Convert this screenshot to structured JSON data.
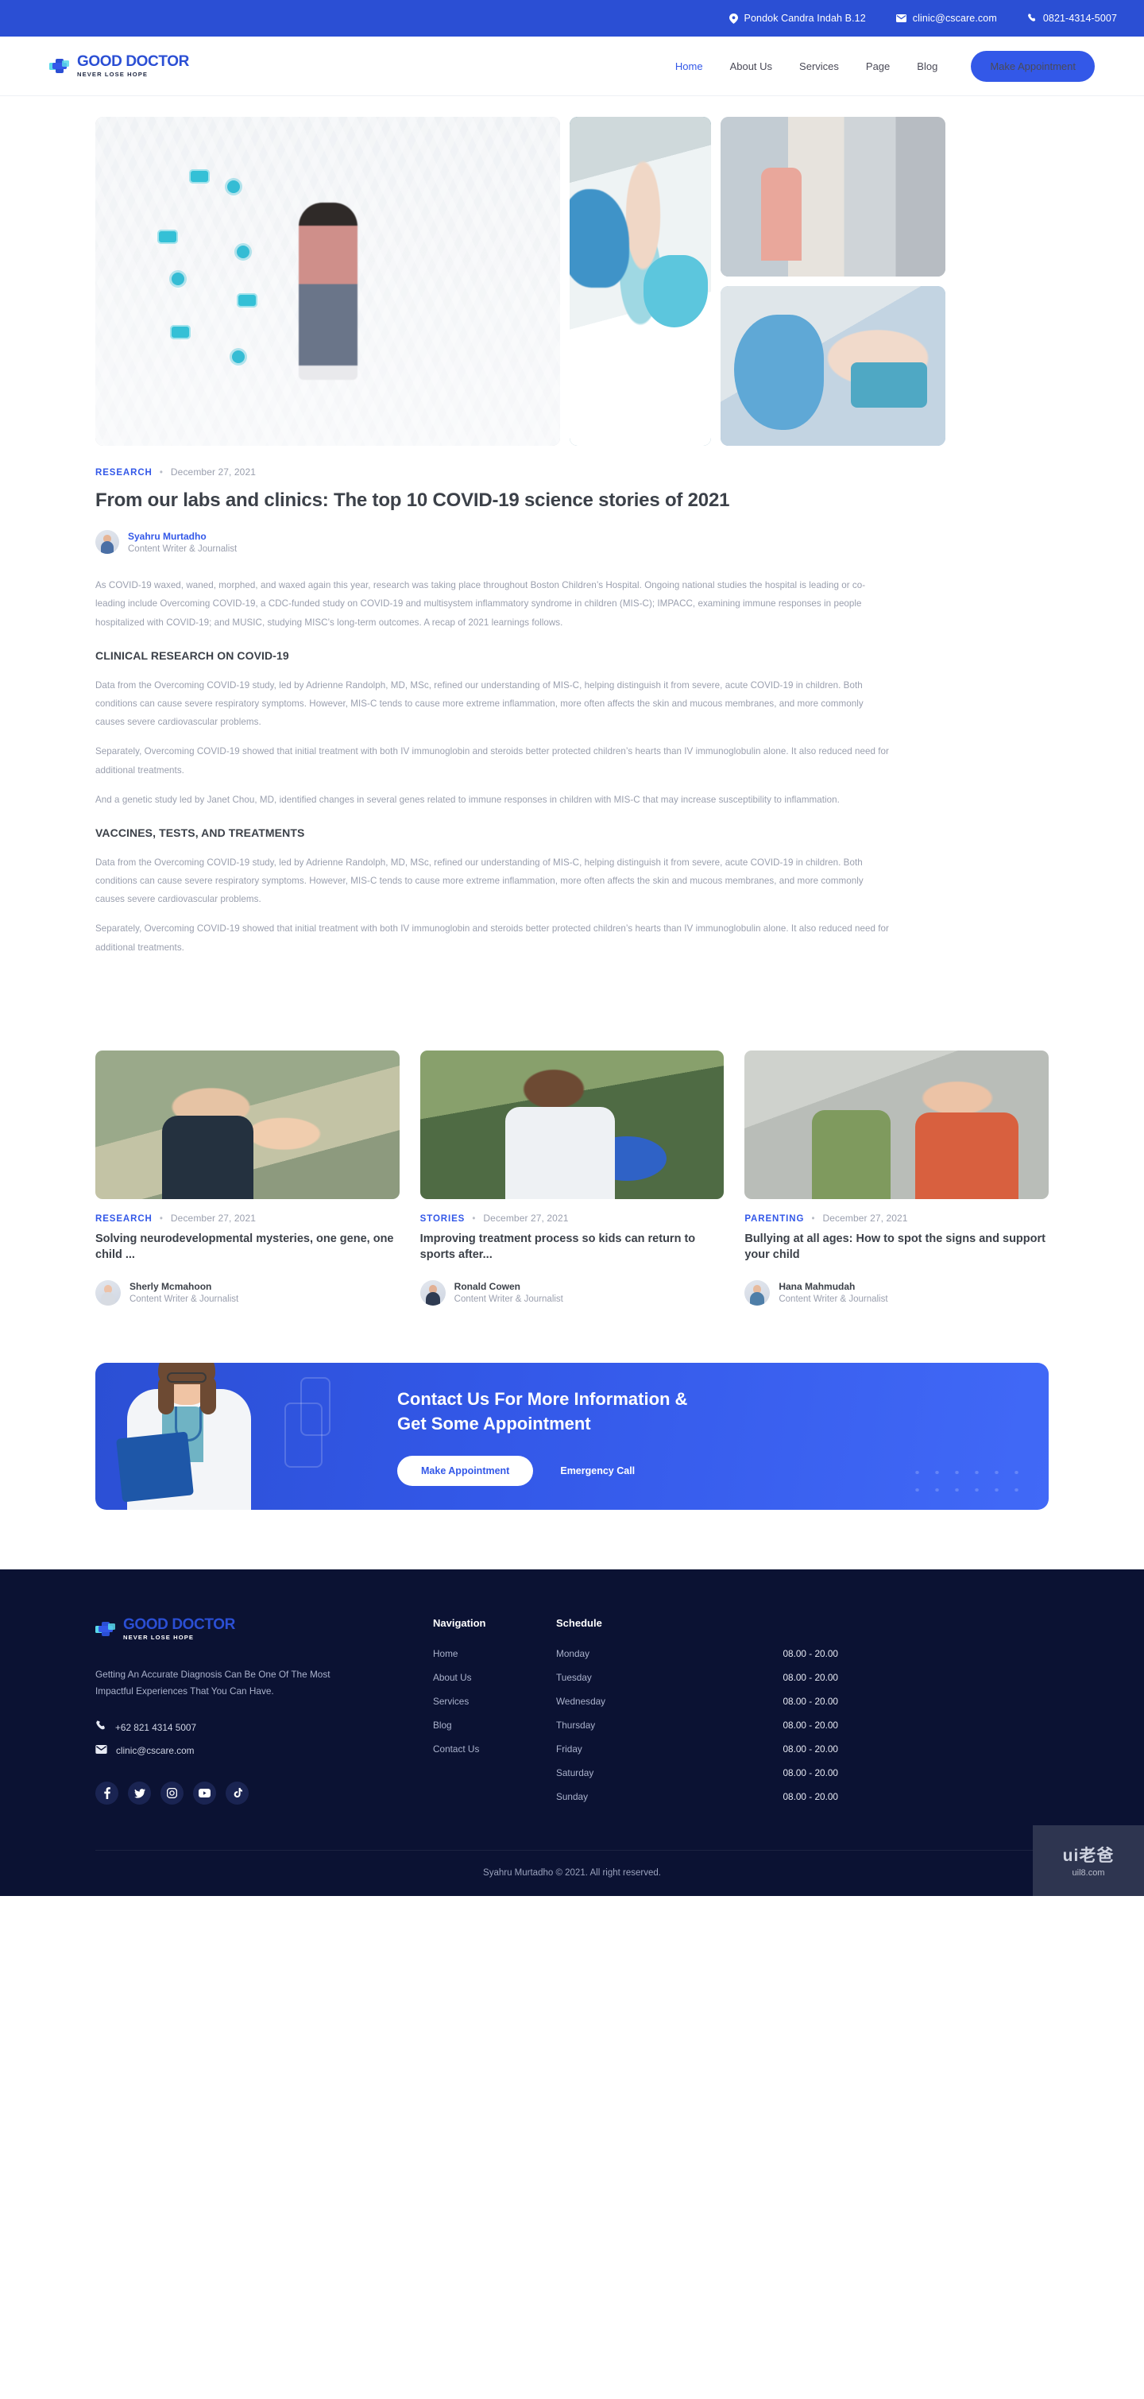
{
  "topbar": {
    "address": "Pondok Candra Indah B.12",
    "email": "clinic@cscare.com",
    "phone": "0821-4314-5007",
    "icons": {
      "location": "location-pin-icon",
      "mail": "mail-icon",
      "phone": "phone-icon"
    }
  },
  "brand": {
    "name": "GOOD DOCTOR",
    "tagline": "NEVER LOSE HOPE"
  },
  "nav": {
    "items": [
      {
        "label": "Home",
        "active": true
      },
      {
        "label": "About Us",
        "active": false
      },
      {
        "label": "Services",
        "active": false
      },
      {
        "label": "Page",
        "active": false
      },
      {
        "label": "Blog",
        "active": false
      }
    ],
    "cta": "Make Appointment"
  },
  "article": {
    "category": "RESEARCH",
    "separator": "•",
    "date": "December 27, 2021",
    "title": "From our labs and clinics: The top 10 COVID-19 science stories of 2021",
    "author": {
      "name": "Syahru Murtadho",
      "role": "Content Writer & Journalist"
    },
    "intro": "As COVID-19 waxed, waned, morphed, and waxed again this year, research was taking place throughout Boston Children’s Hospital. Ongoing national studies the hospital is leading or co-leading include Overcoming COVID-19, a CDC-funded study on COVID-19 and multisystem inflammatory syndrome in children (MIS-C); IMPACC, examining immune responses in people hospitalized with COVID-19; and MUSIC, studying MISC’s long-term outcomes. A recap of 2021 learnings follows.",
    "sections": [
      {
        "heading": "CLINICAL RESEARCH ON COVID-19",
        "paragraphs": [
          "Data from the Overcoming COVID-19 study, led by Adrienne Randolph, MD, MSc, refined our understanding of MIS-C, helping distinguish it from severe, acute COVID-19 in children. Both conditions can cause severe respiratory symptoms. However, MIS-C tends to cause more extreme inflammation, more often affects the skin and mucous membranes, and more commonly causes severe cardiovascular problems.",
          "Separately, Overcoming COVID-19 showed that initial treatment with both IV immunoglobin and steroids better protected children’s hearts than IV immunoglobulin alone. It also reduced need for additional treatments.",
          "And a genetic study led by Janet Chou, MD, identified changes in several genes related to immune responses in children with MIS-C that may increase susceptibility to inflammation."
        ]
      },
      {
        "heading": "VACCINES, TESTS, AND TREATMENTS",
        "paragraphs": [
          "Data from the Overcoming COVID-19 study, led by Adrienne Randolph, MD, MSc, refined our understanding of MIS-C, helping distinguish it from severe, acute COVID-19 in children. Both conditions can cause severe respiratory symptoms. However, MIS-C tends to cause more extreme inflammation, more often affects the skin and mucous membranes, and more commonly causes severe cardiovascular problems.",
          "Separately, Overcoming COVID-19 showed that initial treatment with both IV immunoglobin and steroids better protected children’s hearts than IV immunoglobulin alone. It also reduced need for additional treatments."
        ]
      }
    ],
    "gallery": [
      {
        "name": "hero-street-masked-woman"
      },
      {
        "name": "medic-in-ppe-portrait"
      },
      {
        "name": "clinic-vaccination-queue"
      },
      {
        "name": "vaccine-syringe-closeup"
      }
    ]
  },
  "related": [
    {
      "category": "RESEARCH",
      "date": "December 27, 2021",
      "title": "Solving neurodevelopmental mysteries, one gene, one child ...",
      "author": {
        "name": "Sherly Mcmahoon",
        "role": "Content Writer & Journalist"
      },
      "image": "children-portrait"
    },
    {
      "category": "STORIES",
      "date": "December 27, 2021",
      "title": "Improving treatment process so kids can return to sports after...",
      "author": {
        "name": "Ronald Cowen",
        "role": "Content Writer & Journalist"
      },
      "image": "basketball-teen"
    },
    {
      "category": "PARENTING",
      "date": "December 27, 2021",
      "title": "Bullying at all ages: How to spot the signs and support your child",
      "author": {
        "name": "Hana Mahmudah",
        "role": "Content Writer & Journalist"
      },
      "image": "teens-with-phone"
    }
  ],
  "cta": {
    "headline_line1": "Contact Us For More Information &",
    "headline_line2": "Get Some Appointment",
    "primary_button": "Make Appointment",
    "secondary_link": "Emergency Call"
  },
  "footer": {
    "description": "Getting An Accurate Diagnosis Can Be One Of The Most Impactful Experiences That You Can Have.",
    "phone": "+62 821 4314 5007",
    "email": "clinic@cscare.com",
    "socials": [
      "facebook-icon",
      "twitter-icon",
      "instagram-icon",
      "youtube-icon",
      "tiktok-icon"
    ],
    "nav_heading": "Navigation",
    "nav_links": [
      "Home",
      "About Us",
      "Services",
      "Blog",
      "Contact Us"
    ],
    "schedule_heading": "Schedule",
    "schedule": [
      {
        "day": "Monday",
        "hours": "08.00 - 20.00"
      },
      {
        "day": "Tuesday",
        "hours": "08.00 - 20.00"
      },
      {
        "day": "Wednesday",
        "hours": "08.00 - 20.00"
      },
      {
        "day": "Thursday",
        "hours": "08.00 - 20.00"
      },
      {
        "day": "Friday",
        "hours": "08.00 - 20.00"
      },
      {
        "day": "Saturday",
        "hours": "08.00 - 20.00"
      },
      {
        "day": "Sunday",
        "hours": "08.00 - 20.00"
      }
    ],
    "copyright": "Syahru Murtadho © 2021. All right reserved."
  },
  "watermark": {
    "top": "ui老爸",
    "bottom": "uil8.com"
  },
  "colors": {
    "primary": "#3358e8",
    "topbar": "#2b4fd4",
    "footer_bg": "#0b1233",
    "muted_text": "#9a9fae",
    "heading": "#3c4149"
  }
}
